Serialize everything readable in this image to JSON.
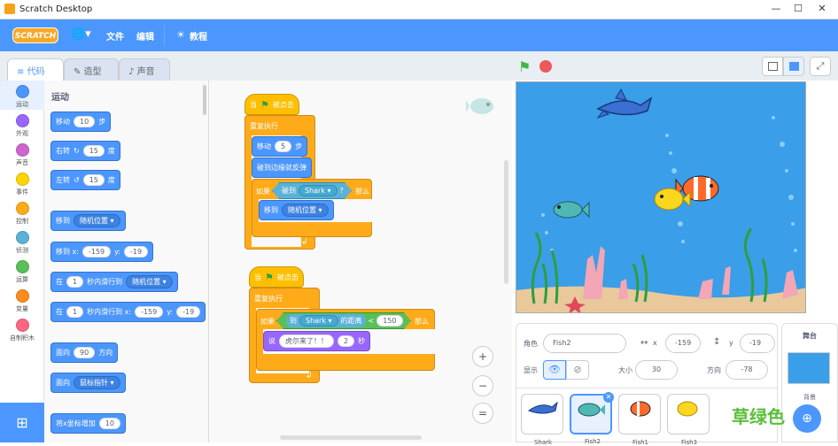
{
  "window": {
    "title": "Scratch Desktop",
    "minimize": "—",
    "maximize": "☐",
    "close": "✕"
  },
  "menubar": {
    "logo": "SCRATCH",
    "file": "文件",
    "edit": "编辑",
    "tutorials": "教程"
  },
  "tabs": [
    {
      "label": "代码"
    },
    {
      "label": "造型"
    },
    {
      "label": "声音"
    }
  ],
  "categories": [
    {
      "label": "运动",
      "color": "#4c97ff"
    },
    {
      "label": "外观",
      "color": "#9966ff"
    },
    {
      "label": "声音",
      "color": "#cf63cf"
    },
    {
      "label": "事件",
      "color": "#ffd500"
    },
    {
      "label": "控制",
      "color": "#ffab19"
    },
    {
      "label": "侦测",
      "color": "#5cb1d6"
    },
    {
      "label": "运算",
      "color": "#59c059"
    },
    {
      "label": "变量",
      "color": "#ff8c1a"
    },
    {
      "label": "自制积木",
      "color": "#ff6680"
    }
  ],
  "palette": {
    "heading": "运动",
    "move": {
      "a": "移动",
      "v": "10",
      "b": "步"
    },
    "turn_r": {
      "a": "右转",
      "icon": "↻",
      "v": "15",
      "b": "度"
    },
    "turn_l": {
      "a": "左转",
      "icon": "↺",
      "v": "15",
      "b": "度"
    },
    "goto": {
      "a": "移到",
      "d": "随机位置"
    },
    "gotoxy": {
      "a": "移到 x:",
      "x": "-159",
      "ylabel": "y:",
      "y": "-19"
    },
    "glide": {
      "a": "在",
      "v": "1",
      "b": "秒内滑行到",
      "d": "随机位置"
    },
    "glidexy": {
      "a": "在",
      "v": "1",
      "b": "秒内滑行到 x:",
      "x": "-159",
      "ylabel": "y:",
      "y": "-19"
    },
    "point": {
      "a": "面向",
      "v": "90",
      "b": "方向"
    },
    "pointto": {
      "a": "面向",
      "d": "鼠标指针"
    },
    "changex": {
      "a": "将x坐标增加",
      "v": "10"
    }
  },
  "script1": {
    "when": "当",
    "flag": "被点击",
    "forever": "重复执行",
    "move_a": "移动",
    "move_v": "5",
    "move_b": "步",
    "bounce": "碰到边缘就反弹",
    "if": "如果",
    "touching": "碰到",
    "touch_d": "Shark",
    "q": "?",
    "then": "那么",
    "goto": "移到",
    "goto_d": "随机位置"
  },
  "script2": {
    "when": "当",
    "flag": "被点击",
    "forever": "重复执行",
    "if": "如果",
    "to": "到",
    "to_d": "Shark",
    "dist": "的距离",
    "lt": "<",
    "lt_v": "150",
    "then": "那么",
    "say": "说",
    "say_t": "虎尔来了！！",
    "say_v": "2",
    "say_b": "秒"
  },
  "zoom": {
    "in": "+",
    "out": "−",
    "reset": "="
  },
  "sprite": {
    "sprite_label": "角色",
    "sprite_name": "Fish2",
    "x_label": "x",
    "x": "-159",
    "y_label": "y",
    "y": "-19",
    "show_label": "显示",
    "size_label": "大小",
    "size": "30",
    "dir_label": "方向",
    "dir": "-78"
  },
  "sprites": [
    {
      "name": "Shark"
    },
    {
      "name": "Fish2"
    },
    {
      "name": "Fish1"
    },
    {
      "name": "Fish3"
    }
  ],
  "stagepanel": {
    "title": "舞台",
    "backdrop": "背景"
  },
  "watermark": "草绿色",
  "colors": {
    "accent": "#4c97ff",
    "motion": "#4c97ff",
    "events": "#ffbf00",
    "control": "#ffab19",
    "sensing": "#5cb1d6",
    "operators": "#59c059",
    "looks": "#9966ff"
  }
}
